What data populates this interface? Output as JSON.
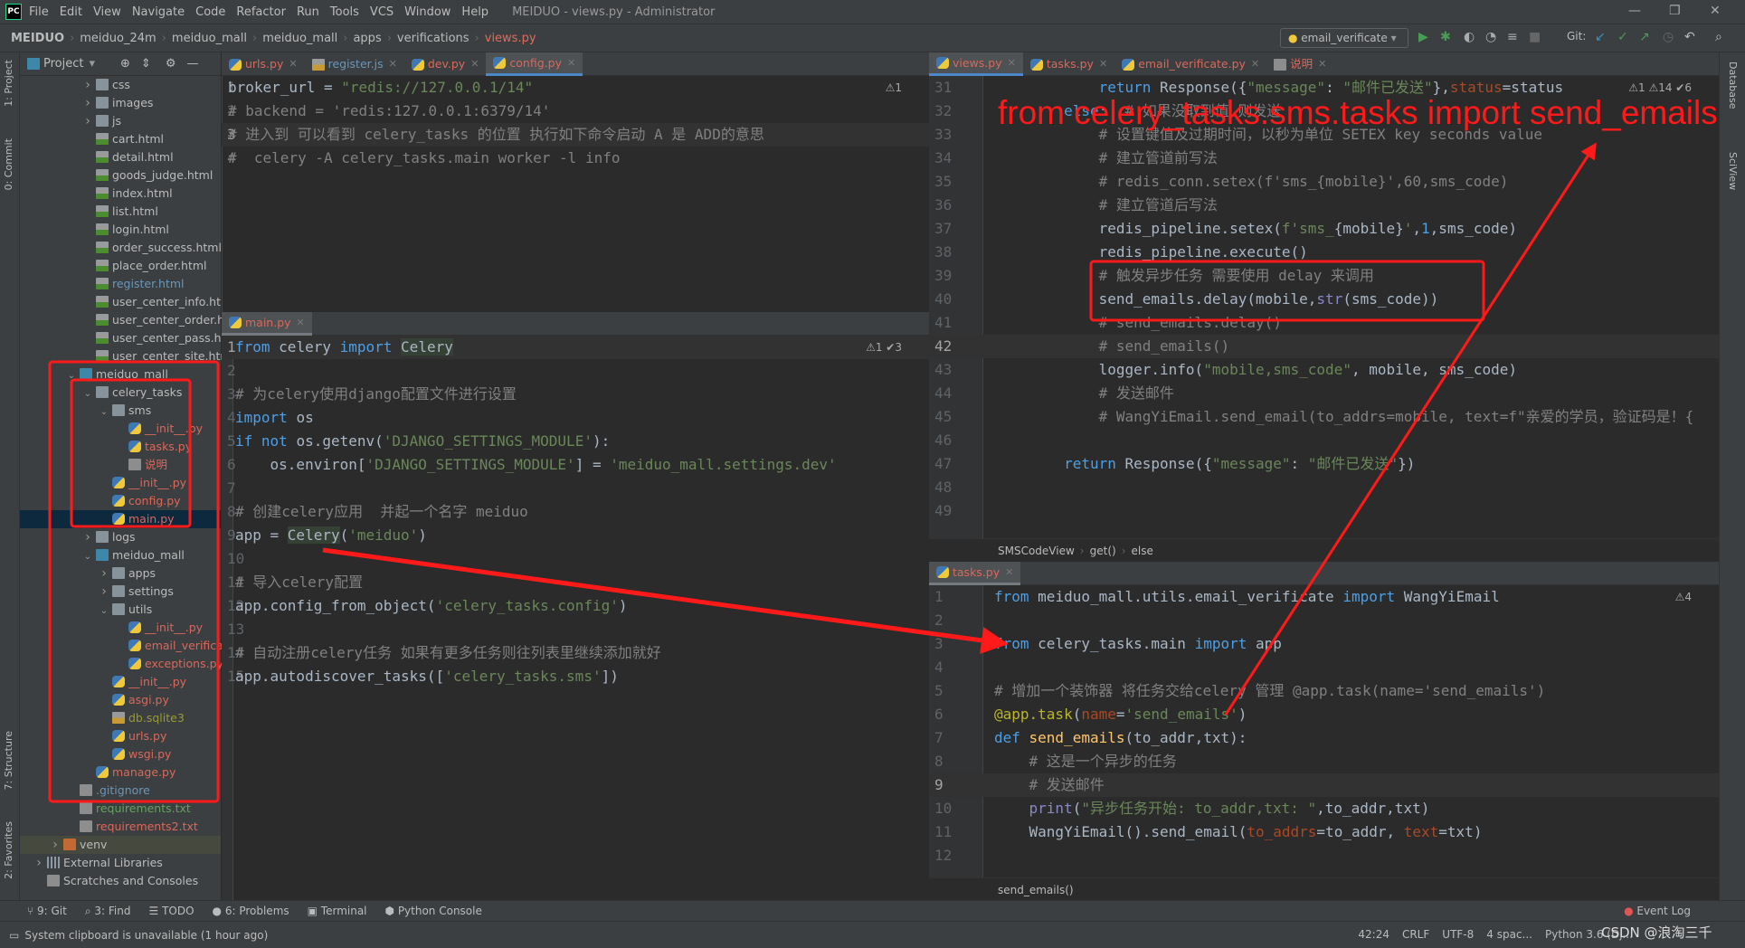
{
  "window": {
    "title": "MEIDUO - views.py - Administrator",
    "logo": "PC"
  },
  "menu": [
    "File",
    "Edit",
    "View",
    "Navigate",
    "Code",
    "Refactor",
    "Run",
    "Tools",
    "VCS",
    "Window",
    "Help"
  ],
  "breadcrumb": [
    "MEIDUO",
    "meiduo_24m",
    "meiduo_mall",
    "meiduo_mall",
    "apps",
    "verifications",
    "views.py"
  ],
  "toolbar": {
    "run_config": "email_verificate",
    "git_label": "Git:"
  },
  "left_strip": {
    "project": "1: Project",
    "commit": "0: Commit",
    "structure": "7: Structure",
    "favorites": "2: Favorites"
  },
  "right_strip": {
    "database": "Database",
    "sciview": "SciView"
  },
  "project_panel": {
    "title": "Project",
    "tree": [
      {
        "label": "css",
        "level": 3,
        "type": "folder",
        "expand": "closed"
      },
      {
        "label": "images",
        "level": 3,
        "type": "folder",
        "expand": "closed"
      },
      {
        "label": "js",
        "level": 3,
        "type": "folder",
        "expand": "closed"
      },
      {
        "label": "cart.html",
        "level": 3,
        "type": "html"
      },
      {
        "label": "detail.html",
        "level": 3,
        "type": "html"
      },
      {
        "label": "goods_judge.html",
        "level": 3,
        "type": "html"
      },
      {
        "label": "index.html",
        "level": 3,
        "type": "html"
      },
      {
        "label": "list.html",
        "level": 3,
        "type": "html"
      },
      {
        "label": "login.html",
        "level": 3,
        "type": "html"
      },
      {
        "label": "order_success.html",
        "level": 3,
        "type": "html"
      },
      {
        "label": "place_order.html",
        "level": 3,
        "type": "html"
      },
      {
        "label": "register.html",
        "level": 3,
        "type": "html",
        "color": "blue"
      },
      {
        "label": "user_center_info.html",
        "level": 3,
        "type": "html"
      },
      {
        "label": "user_center_order.html",
        "level": 3,
        "type": "html"
      },
      {
        "label": "user_center_pass.html",
        "level": 3,
        "type": "html"
      },
      {
        "label": "user_center_site.html",
        "level": 3,
        "type": "html"
      },
      {
        "label": "meiduo_mall",
        "level": 2,
        "type": "folder-blue",
        "expand": "open"
      },
      {
        "label": "celery_tasks",
        "level": 3,
        "type": "folder",
        "expand": "open"
      },
      {
        "label": "sms",
        "level": 4,
        "type": "folder",
        "expand": "open"
      },
      {
        "label": "__init__.py",
        "level": 5,
        "type": "py",
        "color": "red"
      },
      {
        "label": "tasks.py",
        "level": 5,
        "type": "py",
        "color": "red"
      },
      {
        "label": "说明",
        "level": 5,
        "type": "txt",
        "color": "red"
      },
      {
        "label": "__init__.py",
        "level": 4,
        "type": "py",
        "color": "red"
      },
      {
        "label": "config.py",
        "level": 4,
        "type": "py",
        "color": "red"
      },
      {
        "label": "main.py",
        "level": 4,
        "type": "py",
        "color": "red",
        "selected": true
      },
      {
        "label": "logs",
        "level": 3,
        "type": "folder",
        "expand": "closed"
      },
      {
        "label": "meiduo_mall",
        "level": 3,
        "type": "folder-blue",
        "expand": "open"
      },
      {
        "label": "apps",
        "level": 4,
        "type": "folder",
        "expand": "closed"
      },
      {
        "label": "settings",
        "level": 4,
        "type": "folder",
        "expand": "closed"
      },
      {
        "label": "utils",
        "level": 4,
        "type": "folder",
        "expand": "open"
      },
      {
        "label": "__init__.py",
        "level": 5,
        "type": "py",
        "color": "red"
      },
      {
        "label": "email_verificate.py",
        "level": 5,
        "type": "py",
        "color": "red"
      },
      {
        "label": "exceptions.py",
        "level": 5,
        "type": "py",
        "color": "red"
      },
      {
        "label": "__init__.py",
        "level": 4,
        "type": "py",
        "color": "red"
      },
      {
        "label": "asgi.py",
        "level": 4,
        "type": "py",
        "color": "red"
      },
      {
        "label": "db.sqlite3",
        "level": 4,
        "type": "sql",
        "color": "olive"
      },
      {
        "label": "urls.py",
        "level": 4,
        "type": "py",
        "color": "red"
      },
      {
        "label": "wsgi.py",
        "level": 4,
        "type": "py",
        "color": "red"
      },
      {
        "label": "manage.py",
        "level": 3,
        "type": "py",
        "color": "red"
      },
      {
        "label": ".gitignore",
        "level": 2,
        "type": "txt",
        "color": "blue"
      },
      {
        "label": "requirements.txt",
        "level": 2,
        "type": "txt",
        "color": "green"
      },
      {
        "label": "requirements2.txt",
        "level": 2,
        "type": "txt",
        "color": "red"
      },
      {
        "label": "venv",
        "level": 1,
        "type": "folder-orange",
        "expand": "closed",
        "highlight": true
      },
      {
        "label": "External Libraries",
        "level": 0,
        "type": "lib",
        "expand": "closed"
      },
      {
        "label": "Scratches and Consoles",
        "level": 0,
        "type": "txt"
      }
    ]
  },
  "left_tabs": [
    {
      "label": "urls.py",
      "color": "red"
    },
    {
      "label": "register.js",
      "color": "blue"
    },
    {
      "label": "dev.py",
      "color": "red"
    },
    {
      "label": "config.py",
      "color": "red",
      "active": true
    }
  ],
  "right_tabs": [
    {
      "label": "views.py",
      "color": "red",
      "active": true
    },
    {
      "label": "tasks.py",
      "color": "red"
    },
    {
      "label": "email_verificate.py",
      "color": "red"
    },
    {
      "label": "说明",
      "color": "red"
    }
  ],
  "editors": {
    "config": {
      "inspection": "⚠1",
      "start": 1,
      "current": 3,
      "lines": [
        [
          [
            "def",
            "broker_url = "
          ],
          [
            "str",
            "\"redis://127.0.0.1/14\""
          ]
        ],
        [
          [
            "cm",
            "# backend = 'redis:127.0.0.1:6379/14'"
          ]
        ],
        [
          [
            "cm",
            "# 进入到 可以看到 celery_tasks 的位置 执行如下命令启动 A 是 ADD的意思"
          ]
        ],
        [
          [
            "cm",
            "#  celery -A celery_tasks.main worker -l info"
          ]
        ]
      ]
    },
    "main": {
      "tab": "main.py",
      "inspection": "⚠1 ✔3",
      "start": 1,
      "current": 1,
      "lines": [
        [
          [
            "kw",
            "from "
          ],
          [
            "def",
            "celery "
          ],
          [
            "kw",
            "import "
          ],
          [
            "hl",
            "Celery"
          ]
        ],
        [],
        [
          [
            "cm",
            "# 为celery使用django配置文件进行设置"
          ]
        ],
        [
          [
            "kw",
            "import "
          ],
          [
            "def",
            "os"
          ]
        ],
        [
          [
            "kw",
            "if not "
          ],
          [
            "def",
            "os.getenv("
          ],
          [
            "str",
            "'DJANGO_SETTINGS_MODULE'"
          ],
          [
            "def",
            "):"
          ]
        ],
        [
          [
            "def",
            "    os.environ["
          ],
          [
            "str",
            "'DJANGO_SETTINGS_MODULE'"
          ],
          [
            "def",
            "] = "
          ],
          [
            "str",
            "'meiduo_mall.settings.dev'"
          ]
        ],
        [],
        [
          [
            "cm",
            "# 创建celery应用  并起一个名字 meiduo"
          ]
        ],
        [
          [
            "def",
            "app = "
          ],
          [
            "hl",
            "Celery"
          ],
          [
            "def",
            "("
          ],
          [
            "str",
            "'meiduo'"
          ],
          [
            "def",
            ")"
          ]
        ],
        [],
        [
          [
            "cm",
            "# 导入celery配置"
          ]
        ],
        [
          [
            "def",
            "app.config_from_object("
          ],
          [
            "str",
            "'celery_tasks.config'"
          ],
          [
            "def",
            ")"
          ]
        ],
        [],
        [
          [
            "cm",
            "# 自动注册celery任务 如果有更多任务则往列表里继续添加就好"
          ]
        ],
        [
          [
            "def",
            "app.autodiscover_tasks(["
          ],
          [
            "str",
            "'celery_tasks.sms'"
          ],
          [
            "def",
            "])"
          ]
        ]
      ]
    },
    "views": {
      "inspection": "⚠1 ⚠14 ✔6",
      "start": 31,
      "current": 42,
      "lines": [
        [
          [
            "kw",
            "            return "
          ],
          [
            "def",
            "Response({"
          ],
          [
            "str",
            "\"message\""
          ],
          [
            "def",
            ": "
          ],
          [
            "str",
            "\"邮件已发送\""
          ],
          [
            "def",
            "},"
          ],
          [
            "par",
            "status"
          ],
          [
            "def",
            "=status"
          ]
        ],
        [
          [
            "kw",
            "        else"
          ],
          [
            "def",
            ":  "
          ],
          [
            "cm",
            "# 如果没取到值 则发送"
          ]
        ],
        [
          [
            "cm",
            "            # 设置键值及过期时间，以秒为单位 SETEX key seconds value"
          ]
        ],
        [
          [
            "cm",
            "            # 建立管道前写法"
          ]
        ],
        [
          [
            "cm",
            "            # redis_conn.setex(f'sms_{mobile}',60,sms_code)"
          ]
        ],
        [
          [
            "cm",
            "            # 建立管道后写法"
          ]
        ],
        [
          [
            "def",
            "            redis_pipeline.setex("
          ],
          [
            "str",
            "f'sms_"
          ],
          [
            "def",
            "{mobile}"
          ],
          [
            "str",
            "'"
          ],
          [
            "def",
            ","
          ],
          [
            "kw",
            "1"
          ],
          [
            "def",
            ",sms_code)"
          ]
        ],
        [
          [
            "def",
            "            redis_pipeline.execute()"
          ]
        ],
        [
          [
            "cm",
            "            # 触发异步任务 需要使用 delay 来调用"
          ]
        ],
        [
          [
            "def",
            "            send_emails.delay(mobile,"
          ],
          [
            "bi",
            "str"
          ],
          [
            "def",
            "(sms_code))"
          ]
        ],
        [
          [
            "cm",
            "            # send_emails.delay()"
          ]
        ],
        [
          [
            "cm",
            "            # send_emails()"
          ]
        ],
        [
          [
            "def",
            "            logger.info("
          ],
          [
            "str",
            "\"mobile,sms_code\""
          ],
          [
            "def",
            ", mobile, sms_code)"
          ]
        ],
        [
          [
            "cm",
            "            # 发送邮件"
          ]
        ],
        [
          [
            "cm",
            "            # WangYiEmail.send_email(to_addrs=mobile, text=f\"亲爱的学员，验证码是！{"
          ]
        ],
        [],
        [
          [
            "kw",
            "        return "
          ],
          [
            "def",
            "Response({"
          ],
          [
            "str",
            "\"message\""
          ],
          [
            "def",
            ": "
          ],
          [
            "str",
            "\"邮件已发送\""
          ],
          [
            "def",
            "})"
          ]
        ],
        [],
        []
      ],
      "breadcrumb": [
        "SMSCodeView",
        "get()",
        "else"
      ]
    },
    "tasks": {
      "tab": "tasks.py",
      "inspection": "⚠4",
      "start": 1,
      "current": 9,
      "lines": [
        [
          [
            "kw",
            "from "
          ],
          [
            "def",
            "meiduo_mall.utils.email_verificate "
          ],
          [
            "kw",
            "import "
          ],
          [
            "def",
            "WangYiEmail"
          ]
        ],
        [],
        [
          [
            "kw",
            "from "
          ],
          [
            "def",
            "celery_tasks.main "
          ],
          [
            "kw",
            "import "
          ],
          [
            "def",
            "app"
          ]
        ],
        [],
        [
          [
            "cm",
            "# 增加一个装饰器 将任务交给celery 管理 @app.task(name='send_emails')"
          ]
        ],
        [
          [
            "dec",
            "@app.task"
          ],
          [
            "def",
            "("
          ],
          [
            "par",
            "name"
          ],
          [
            "def",
            "="
          ],
          [
            "str",
            "'send_emails'"
          ],
          [
            "def",
            ")"
          ]
        ],
        [
          [
            "kw",
            "def "
          ],
          [
            "fn",
            "send_emails"
          ],
          [
            "def",
            "(to_addr,txt):"
          ]
        ],
        [
          [
            "cm",
            "    # 这是一个异步的任务"
          ]
        ],
        [
          [
            "cm",
            "    # 发送邮件"
          ]
        ],
        [
          [
            "bi",
            "    print"
          ],
          [
            "def",
            "("
          ],
          [
            "str",
            "\"异步任务开始: to_addr,txt: \""
          ],
          [
            "def",
            ",to_addr,txt)"
          ]
        ],
        [
          [
            "def",
            "    WangYiEmail().send_email("
          ],
          [
            "par",
            "to_addrs"
          ],
          [
            "def",
            "=to_addr, "
          ],
          [
            "par",
            "text"
          ],
          [
            "def",
            "=txt)"
          ]
        ],
        []
      ],
      "breadcrumb": [
        "send_emails()"
      ]
    }
  },
  "bottom_tools": [
    "9: Git",
    "3: Find",
    "TODO",
    "6: Problems",
    "Terminal",
    "Python Console",
    "Event Log"
  ],
  "status": {
    "message": "System clipboard is unavailable (1 hour ago)",
    "position": "42:24",
    "line_ending": "CRLF",
    "encoding": "UTF-8",
    "indent": "4 spac...",
    "interpreter": "Python 3.6 (Dj...",
    "watermark": "CSDN @浪淘三千"
  },
  "annotation": {
    "text": "from celery_tasks.sms.tasks import send_emails",
    "color": "#ff1a1a"
  }
}
